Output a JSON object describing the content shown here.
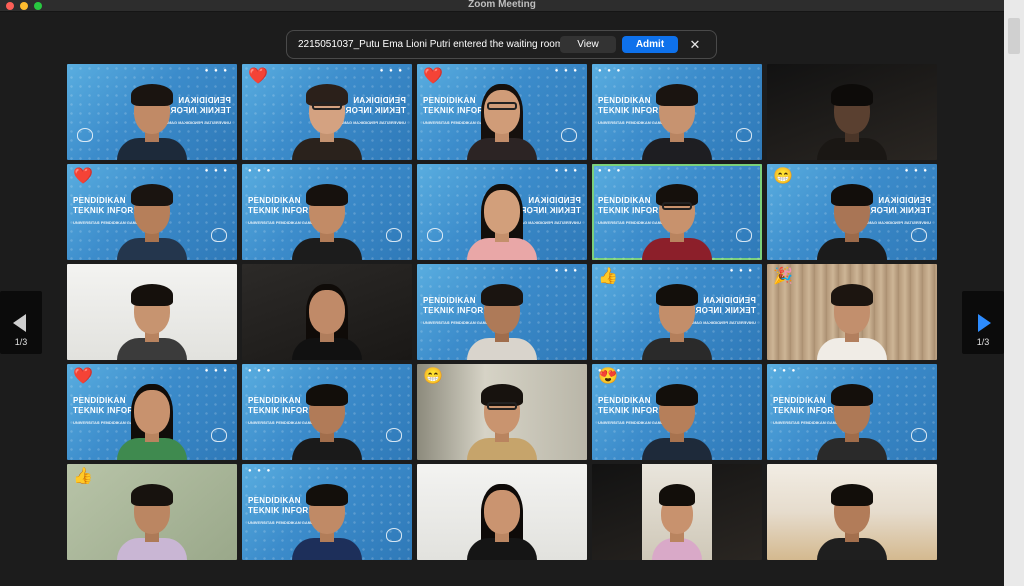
{
  "window": {
    "title": "Zoom Meeting"
  },
  "notification": {
    "text": "2215051037_Putu Ema Lioni Putri entered the waiting room",
    "view_label": "View",
    "admit_label": "Admit",
    "close_label": "✕"
  },
  "pagination": {
    "left_label": "1/3",
    "right_label": "1/3"
  },
  "banner": {
    "line1": "PENDIDIKAN",
    "line2": "TEKNIK INFORMATIKA",
    "line3": "UNIVERSITAS PENDIDIKAN GANESHA"
  },
  "reactions": {
    "heart": "❤️",
    "grin": "😁",
    "thumbs": "👍",
    "party": "🎉",
    "hearteyes": "😍"
  },
  "colors": {
    "accent": "#0e71eb",
    "active_speaker": "#7bd07b",
    "nav_arrow": "#2d8cff"
  }
}
